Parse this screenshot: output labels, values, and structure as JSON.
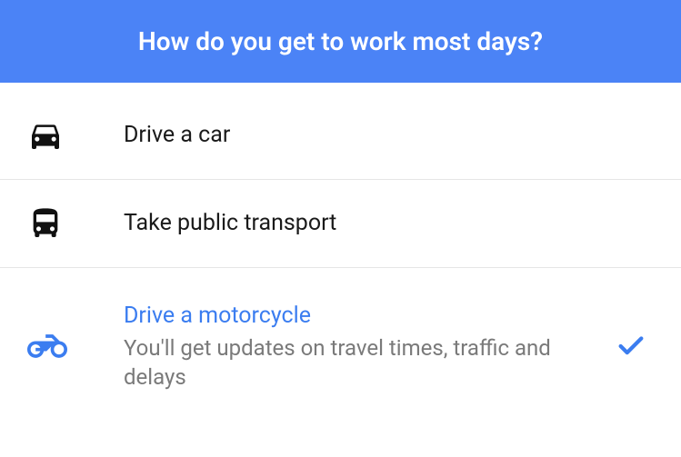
{
  "header": {
    "question": "How do you get to work most days?"
  },
  "options": [
    {
      "label": "Drive a car",
      "subtitle": null,
      "selected": false,
      "icon": "car-icon"
    },
    {
      "label": "Take public transport",
      "subtitle": null,
      "selected": false,
      "icon": "bus-icon"
    },
    {
      "label": "Drive a motorcycle",
      "subtitle": "You'll get updates on travel times, traffic and delays",
      "selected": true,
      "icon": "motorcycle-icon"
    }
  ]
}
